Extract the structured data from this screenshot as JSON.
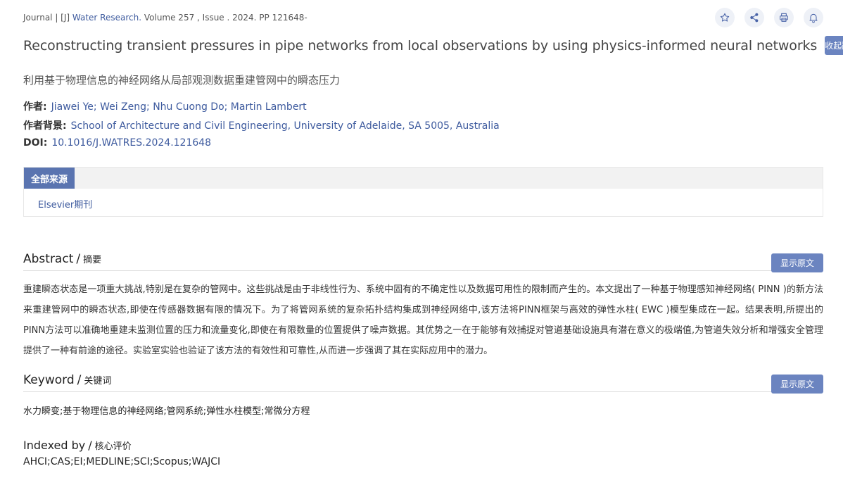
{
  "header": {
    "meta_prefix": "Journal | [J] ",
    "journal": "Water Research.",
    "meta_suffix": " Volume 257 , Issue . 2024. PP 121648-",
    "icons": [
      "star-icon",
      "share-icon",
      "print-icon",
      "bell-icon"
    ]
  },
  "article": {
    "title_en": "Reconstructing transient pressures in pipe networks from local observations by using physics-informed neural networks",
    "collapse_translation_label": "收起翻译",
    "title_zh": "利用基于物理信息的神经网络从局部观测数据重建管网中的瞬态压力",
    "authors_label": "作者:",
    "authors": "Jiawei Ye; Wei Zeng; Nhu Cuong Do; Martin Lambert",
    "affiliation_label": "作者背景:",
    "affiliation": "School of Architecture and Civil Engineering, University of Adelaide, SA 5005, Australia",
    "doi_label": "DOI:",
    "doi": "10.1016/J.WATRES.2024.121648"
  },
  "sources": {
    "tab_label": "全部来源",
    "items": [
      "Elsevier期刊"
    ]
  },
  "abstract": {
    "heading_en": "Abstract",
    "separator": "/",
    "heading_zh": "摘要",
    "show_original_label": "显示原文",
    "text": "重建瞬态状态是一项重大挑战,特别是在复杂的管网中。这些挑战是由于非线性行为、系统中固有的不确定性以及数据可用性的限制而产生的。本文提出了一种基于物理感知神经网络( PINN )的新方法来重建管网中的瞬态状态,即使在传感器数据有限的情况下。为了将管网系统的复杂拓扑结构集成到神经网络中,该方法将PINN框架与高效的弹性水柱( EWC )模型集成在一起。结果表明,所提出的PINN方法可以准确地重建未监测位置的压力和流量变化,即使在有限数量的位置提供了噪声数据。其优势之一在于能够有效捕捉对管道基础设施具有潜在意义的极端值,为管道失效分析和增强安全管理提供了一种有前途的途径。实验室实验也验证了该方法的有效性和可靠性,从而进一步强调了其在实际应用中的潜力。"
  },
  "keyword": {
    "heading_en": "Keyword",
    "separator": "/",
    "heading_zh": "关键词",
    "show_original_label": "显示原文",
    "text": "水力瞬变;基于物理信息的神经网络;管网系统;弹性水柱模型;常微分方程"
  },
  "indexed": {
    "heading_en": "Indexed by",
    "separator": "/",
    "heading_zh": "核心评价",
    "value": "AHCI;CAS;EI;MEDLINE;SCI;Scopus;WAJCI"
  },
  "colors": {
    "accent": "#6b84c0",
    "link": "#3d5a9e",
    "tab_active": "#5a74b0"
  }
}
